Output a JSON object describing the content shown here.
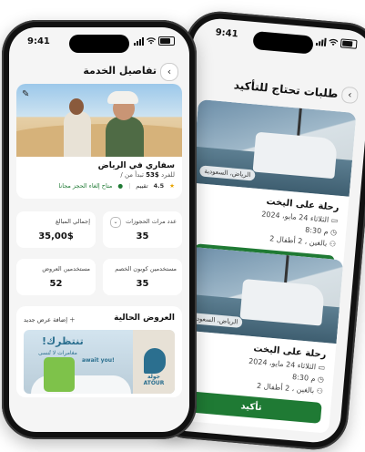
{
  "front": {
    "status_time": "9:41",
    "title": "تفاصيل الخدمة",
    "service": {
      "name": "سفاري في الرياض",
      "price_prefix": "تبدأ من",
      "price": "$53",
      "price_suffix": "/ للفرد",
      "rating": "4.5",
      "rating_label": "تقييم",
      "cancel_note": "متاح إلغاء الحجز مجانا"
    },
    "stats": [
      {
        "label": "عدد مرات الحجوزات",
        "value": "35"
      },
      {
        "label": "إجمالي المبالغ",
        "value": "35,00$"
      },
      {
        "label": "مستخدمين كوبون الخصم",
        "value": "35"
      },
      {
        "label": "مستخدمين العروض",
        "value": "52"
      }
    ],
    "offers": {
      "title": "العروض الحالية",
      "add_label": "إضافة عرض جديد",
      "banner_headline": "!تنتظرك",
      "banner_sub": "مغامرات لا تُنسى",
      "banner_sub_en": "await you!",
      "brand_ar": "جولة",
      "brand_en": "ATOUR"
    }
  },
  "back": {
    "status_time": "9:41",
    "title": "طلبات تحتاج للتأكيد",
    "trips": [
      {
        "title": "رحلة على اليخت",
        "date": "الثلاثاء 24 مايو، 2024",
        "time": "8:30 م",
        "guests": "2 بالغين ، 2 أطفال",
        "badge": "الرياض، السعودية",
        "button": "تأكيد"
      },
      {
        "title": "رحلة على اليخت",
        "date": "الثلاثاء 24 مايو، 2024",
        "time": "8:30 م",
        "guests": "2 بالغين ، 2 أطفال",
        "badge": "الرياض، السعودية",
        "button": "تأكيد"
      }
    ]
  },
  "colors": {
    "accent": "#1f7a34",
    "brand": "#2b6f8f"
  }
}
